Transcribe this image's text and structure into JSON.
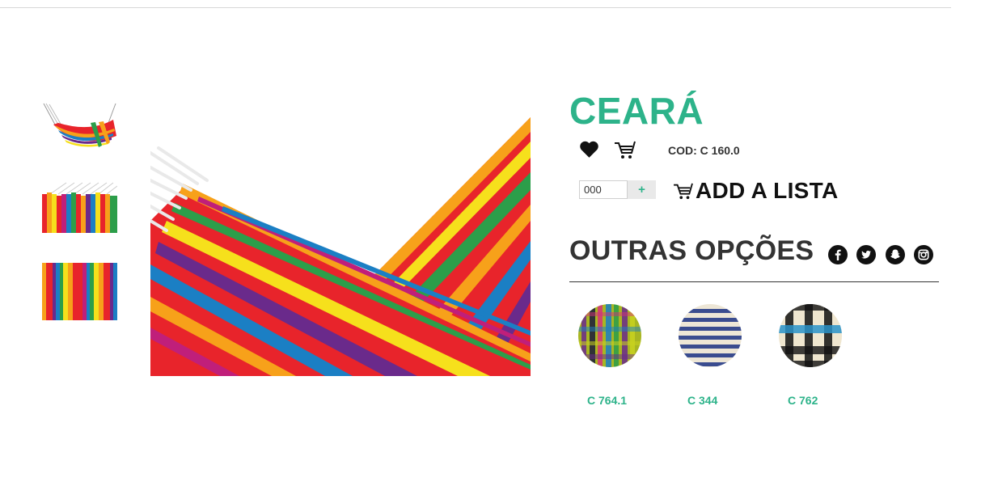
{
  "product": {
    "name": "CEARÁ",
    "code": "COD: C 160.0",
    "quantity_value": "000",
    "quantity_plus": "+",
    "add_to_list_label": "ADD A LISTA"
  },
  "gallery": {
    "thumbnails": [
      "hammock-full-view",
      "hammock-top-edge",
      "fabric-stripes"
    ],
    "main_image": "hammock-closeup"
  },
  "options": {
    "title": "OUTRAS OPÇÕES",
    "social_icons": [
      "facebook-icon",
      "twitter-icon",
      "snapchat-icon",
      "instagram-icon"
    ],
    "items": [
      {
        "code": "C 764.1",
        "swatch": "multicolor-plaid"
      },
      {
        "code": "C 344",
        "swatch": "blue-white-stripes"
      },
      {
        "code": "C 762",
        "swatch": "black-blue-check"
      }
    ]
  },
  "colors": {
    "accent": "#2db38a",
    "text_dark": "#333333",
    "divider": "#333333"
  }
}
